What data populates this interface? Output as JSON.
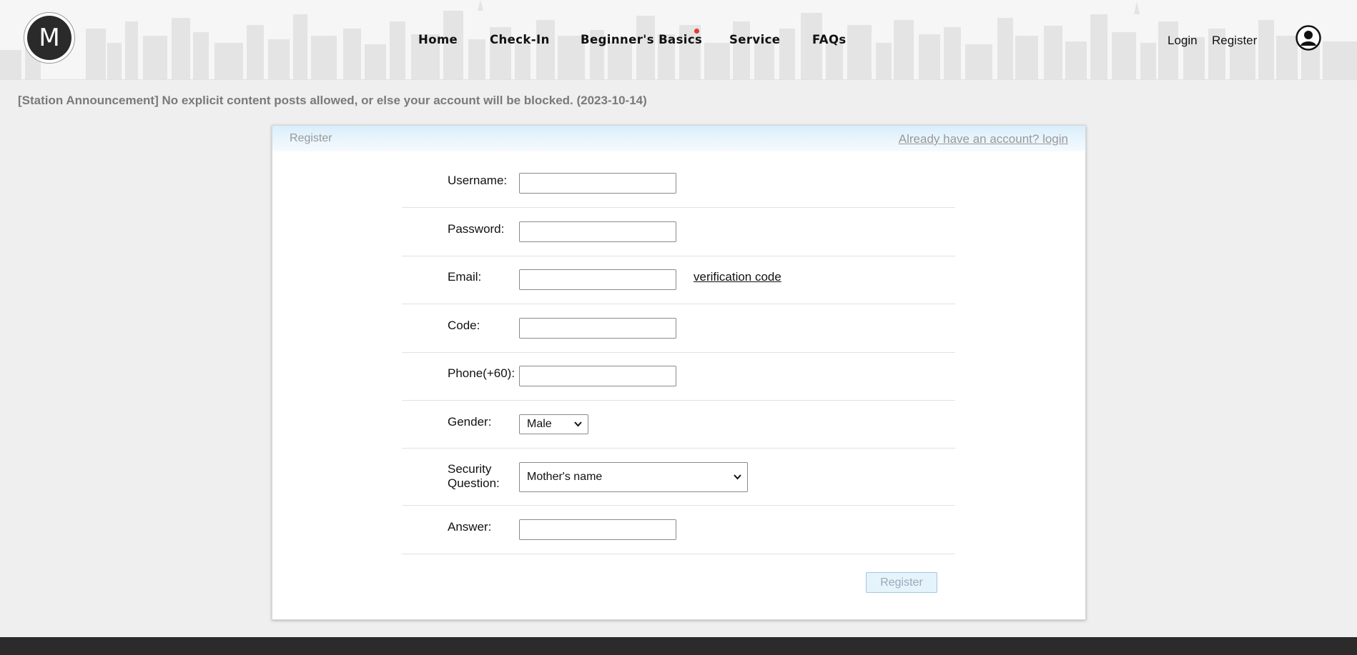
{
  "header": {
    "logo_letter": "M",
    "nav": [
      {
        "label": "Home"
      },
      {
        "label": "Check-In"
      },
      {
        "label": "Beginner's Basics"
      },
      {
        "label": "Service"
      },
      {
        "label": "FAQs"
      }
    ],
    "login_label": "Login",
    "register_label": "Register",
    "notification_color": "#e53935"
  },
  "announcement": "[Station Announcement] No explicit content posts allowed, or else your account will be blocked. (2023-10-14)",
  "card": {
    "title": "Register",
    "login_link": "Already have an account? login"
  },
  "form": {
    "username_label": "Username:",
    "password_label": "Password:",
    "email_label": "Email:",
    "verification_link": "verification code",
    "code_label": "Code:",
    "phone_label": "Phone(+60):",
    "gender_label": "Gender:",
    "gender_value": "Male",
    "security_label_1": "Security",
    "security_label_2": "Question:",
    "security_value": "Mother's name",
    "answer_label": "Answer:",
    "submit_label": "Register"
  }
}
